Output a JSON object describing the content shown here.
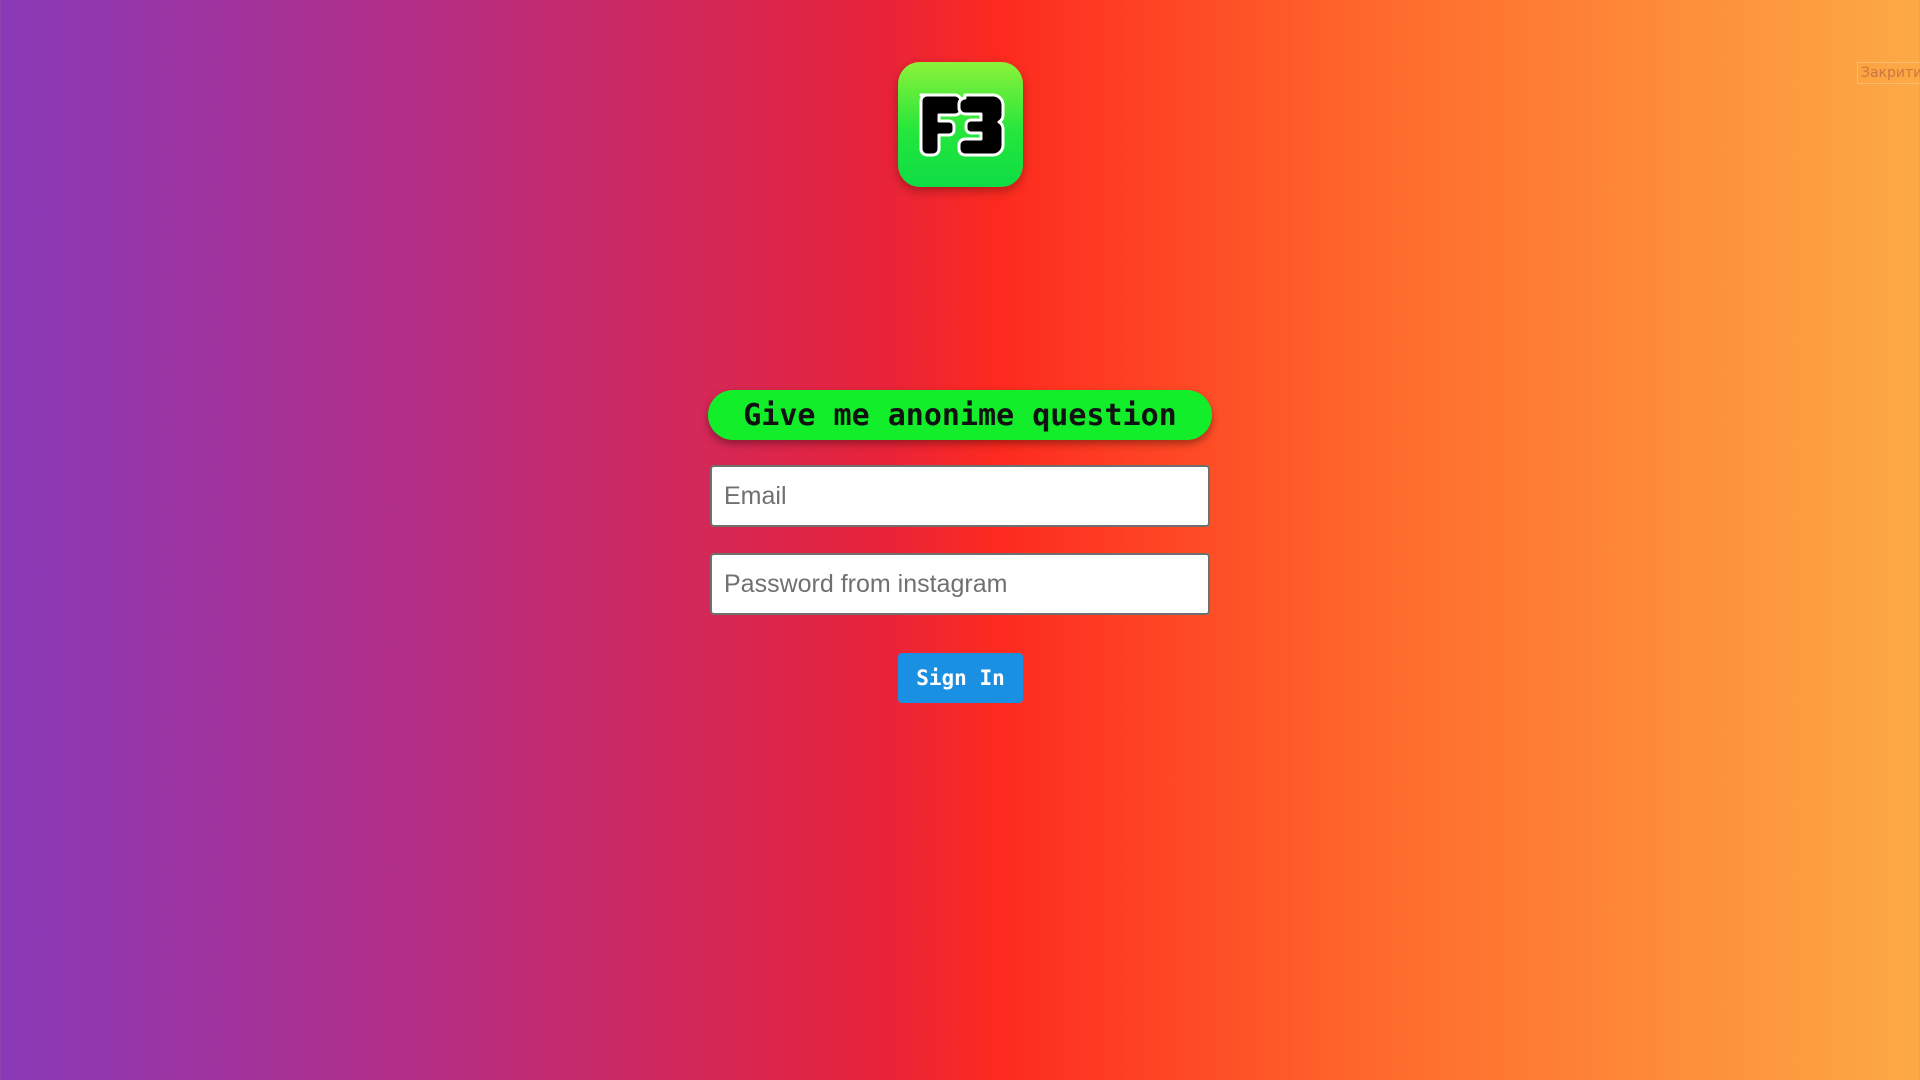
{
  "page": {
    "close_label": "Закрити"
  },
  "logo": {
    "text": "F3",
    "icon": "f3-app-icon",
    "colors": {
      "top": "#8cf23a",
      "bottom": "#0ddd45"
    }
  },
  "form": {
    "heading": "Give me anonime question",
    "email": {
      "placeholder": "Email",
      "value": ""
    },
    "password": {
      "placeholder": "Password from instagram",
      "value": ""
    },
    "submit_label": "Sign In"
  },
  "colors": {
    "background_start": "#8a3ab9",
    "background_mid": "#fd2a1f",
    "background_end": "#fcaa45",
    "heading_bg": "#13ee2a",
    "button_bg": "#1a90e3"
  }
}
